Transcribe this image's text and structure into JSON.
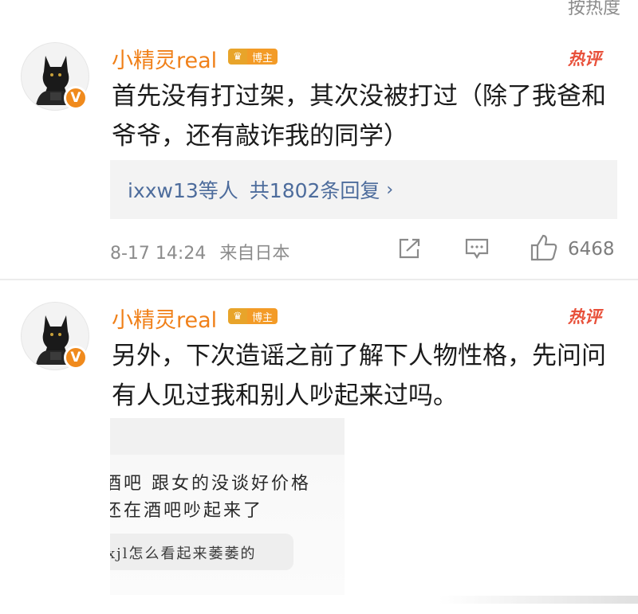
{
  "header": {
    "sort_label": "按热度"
  },
  "comments": [
    {
      "username": "小精灵real",
      "badge_label": "博主",
      "verify_mark": "V",
      "hot_tag": "热评",
      "text": "首先没有打过架，其次没被打过（除了我爸和爷爷，还有敲诈我的同学）",
      "reply_users": "ixxw13等人",
      "reply_count": "共1802条回复",
      "reply_chevron": "›",
      "timestamp": "8-17 14:24",
      "location": "来自日本",
      "likes": "6468"
    },
    {
      "username": "小精灵real",
      "badge_label": "博主",
      "verify_mark": "V",
      "hot_tag": "热评",
      "text": "另外，下次造谣之前了解下人物性格，先问问有人见过我和别人吵起来过吗。",
      "image": {
        "line1": "酒吧 跟女的没谈好价格",
        "line2": "还在酒吧吵起来了",
        "bubble": "xjl怎么看起来萎萎的"
      }
    }
  ],
  "colors": {
    "username": "#f08019",
    "link": "#4d6c9c",
    "hot": "#e8503a",
    "verify": "#f08a1c"
  },
  "icons": [
    "share-icon",
    "comment-icon",
    "like-icon",
    "avatar-wolf-icon",
    "crown-icon"
  ]
}
